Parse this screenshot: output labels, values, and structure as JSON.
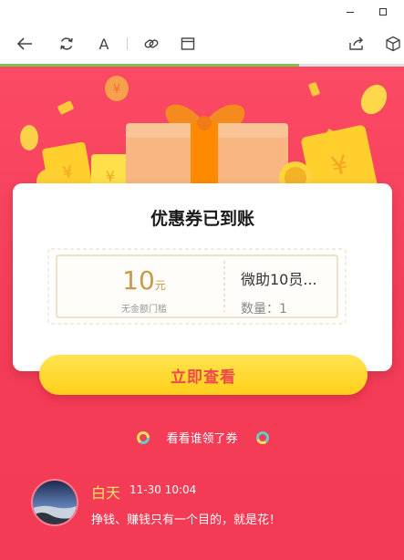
{
  "window": {
    "minimize_icon": "minimize-icon",
    "maximize_icon": "maximize-icon"
  },
  "toolbar": {
    "icons": [
      "back-arrow-icon",
      "refresh-icon",
      "font-icon",
      "link-icon",
      "window-icon",
      "share-icon",
      "cube-icon"
    ],
    "font_label": "A",
    "progress": 0.74
  },
  "colors": {
    "background": "#f43c57",
    "button": "#ffd528",
    "button_text": "#ef4a4a",
    "coupon_gold": "#c99a4b",
    "name_yellow": "#ffe36a"
  },
  "card": {
    "title": "优惠券已到账",
    "coupon": {
      "amount": "10",
      "unit": "元",
      "condition": "无金额门槛",
      "name": "微助10员...",
      "quantity": "数量：1"
    }
  },
  "cta_label": "立即查看",
  "who_got_label": "看看谁领了券",
  "comment": {
    "user": "白天",
    "time": "11-30 10:04",
    "text": "挣钱、赚钱只有一个目的，就是花！"
  }
}
